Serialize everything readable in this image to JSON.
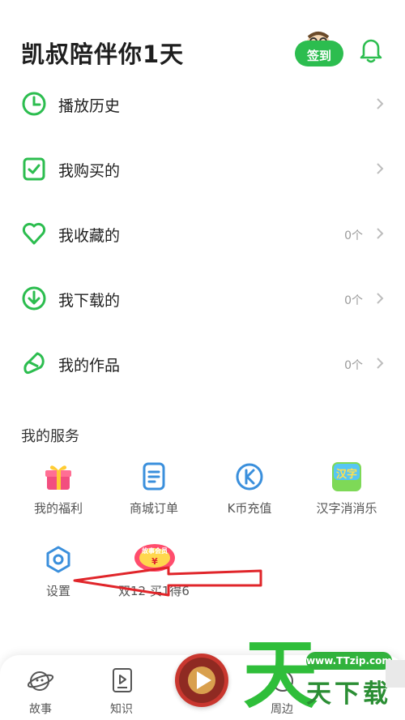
{
  "header": {
    "title": "凯叔陪伴你1天",
    "signin_label": "签到"
  },
  "menu": [
    {
      "label": "播放历史",
      "count": ""
    },
    {
      "label": "我购买的",
      "count": ""
    },
    {
      "label": "我收藏的",
      "count": "0个"
    },
    {
      "label": "我下载的",
      "count": "0个"
    },
    {
      "label": "我的作品",
      "count": "0个"
    }
  ],
  "services": {
    "title": "我的服务",
    "items": [
      {
        "label": "我的福利"
      },
      {
        "label": "商城订单"
      },
      {
        "label": "K币充值"
      },
      {
        "label": "汉字消消乐"
      },
      {
        "label": "设置"
      },
      {
        "label": "双12 买1得6"
      }
    ],
    "hanzi_icon_text": "汉字",
    "promo_image_text": "故事会员"
  },
  "tabbar": {
    "items": [
      {
        "label": "故事"
      },
      {
        "label": "知识"
      },
      {
        "label": ""
      },
      {
        "label": "周边"
      }
    ]
  },
  "watermark": {
    "big": "天",
    "url": "www.TTzip.com",
    "small": "天下载"
  },
  "colors": {
    "accent": "#2cbd4f",
    "icon_blue": "#3a8fdc",
    "arrow_red": "#e0252a",
    "play_red": "#c9372f"
  }
}
